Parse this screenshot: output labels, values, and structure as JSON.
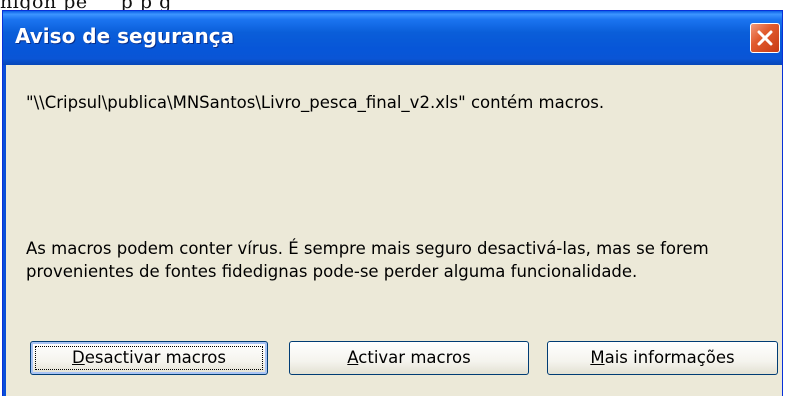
{
  "background_fragment": "nlgon  pe                          _  _p         p         g",
  "dialog": {
    "title": "Aviso de segurança",
    "file_message": "\"\\\\Cripsul\\publica\\MNSantos\\Livro_pesca_final_v2.xls\" contém macros.",
    "warning_message": "As macros podem conter vírus. É sempre mais seguro desactivá-las, mas se forem provenientes de fontes fidedignas pode-se perder alguma funcionalidade."
  },
  "buttons": {
    "disable": {
      "accel": "D",
      "rest": "esactivar macros"
    },
    "enable": {
      "accel": "A",
      "rest": "ctivar macros"
    },
    "more_info": {
      "accel": "M",
      "rest": "ais informações"
    }
  },
  "icons": {
    "close": "close-icon"
  },
  "colors": {
    "titlebar": "#0a5ed9",
    "dialog_bg": "#ece9d8",
    "close_button": "#e15b2e"
  }
}
